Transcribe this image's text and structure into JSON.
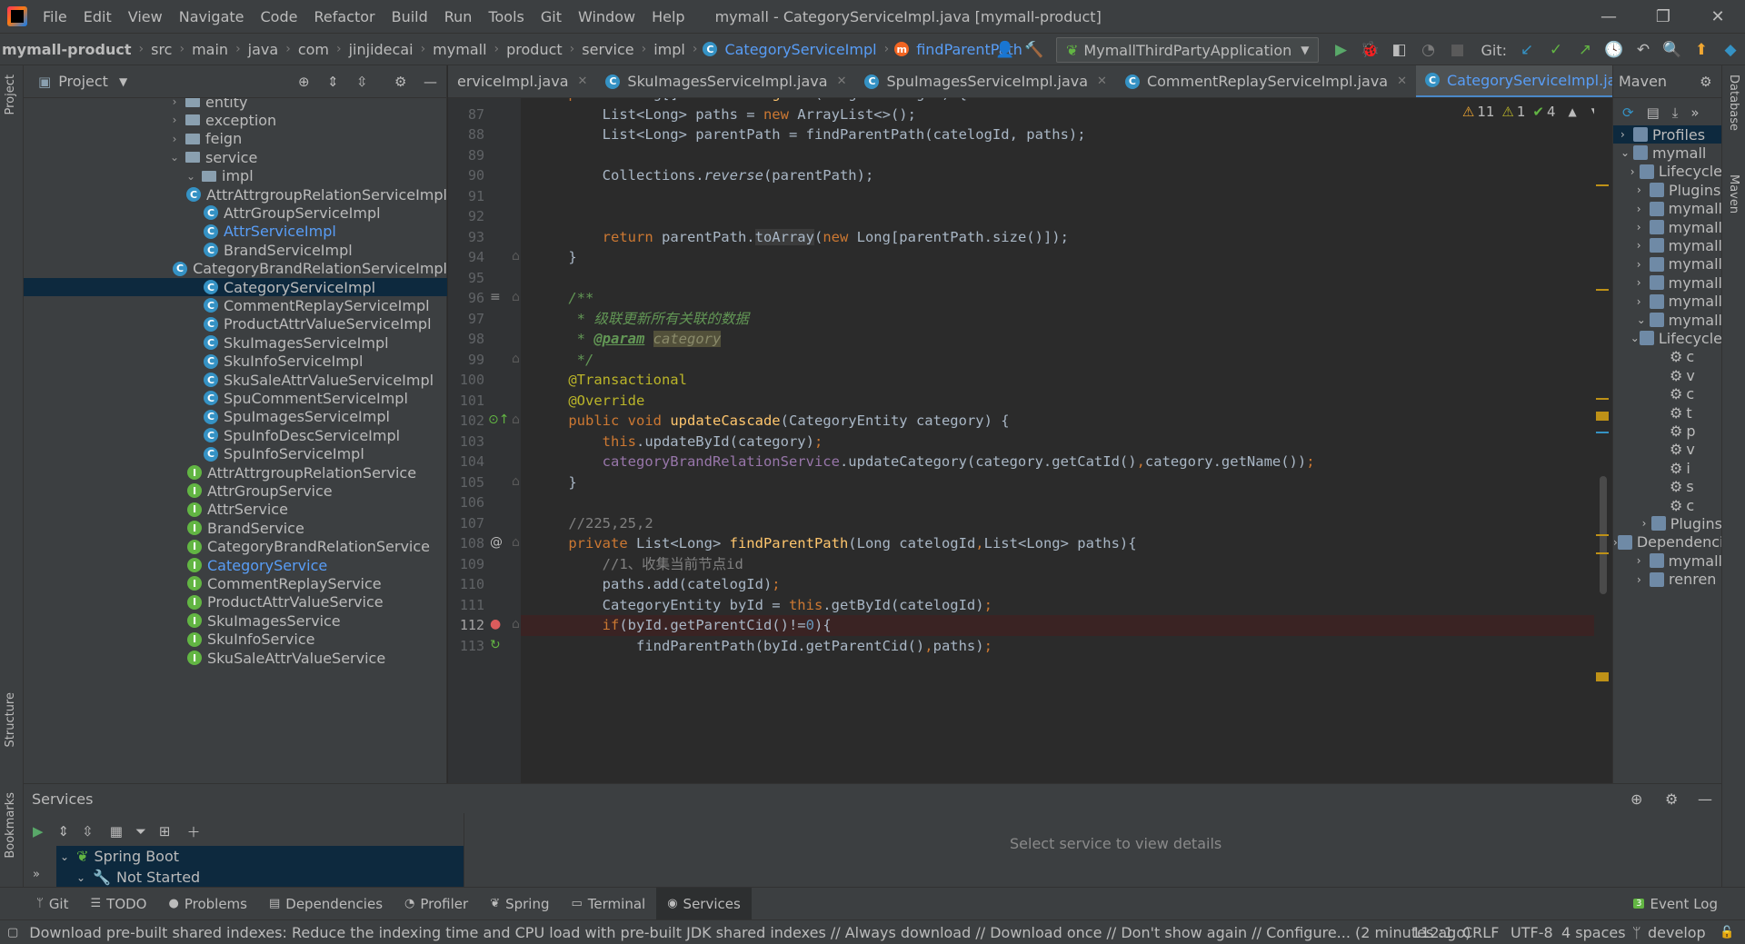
{
  "menubar": {
    "items": [
      "File",
      "Edit",
      "View",
      "Navigate",
      "Code",
      "Refactor",
      "Build",
      "Run",
      "Tools",
      "Git",
      "Window",
      "Help"
    ],
    "title": "mymall - CategoryServiceImpl.java [mymall-product]"
  },
  "navbar": {
    "crumbs": [
      "mymall-product",
      "src",
      "main",
      "java",
      "com",
      "jinjidecai",
      "mymall",
      "product",
      "service",
      "impl",
      "CategoryServiceImpl",
      "findParentPath"
    ],
    "run_config": "MymallThirdPartyApplication",
    "git_label": "Git:"
  },
  "project": {
    "title": "Project",
    "tree": [
      {
        "label": "entity",
        "kind": "folder",
        "indent": 1,
        "arrow": "right"
      },
      {
        "label": "exception",
        "kind": "folder",
        "indent": 1,
        "arrow": "right"
      },
      {
        "label": "feign",
        "kind": "folder",
        "indent": 1,
        "arrow": "right"
      },
      {
        "label": "service",
        "kind": "folder",
        "indent": 1,
        "arrow": "down"
      },
      {
        "label": "impl",
        "kind": "folder",
        "indent": 2,
        "arrow": "down"
      },
      {
        "label": "AttrAttrgroupRelationServiceImpl",
        "kind": "class",
        "indent": 3
      },
      {
        "label": "AttrGroupServiceImpl",
        "kind": "class",
        "indent": 3
      },
      {
        "label": "AttrServiceImpl",
        "kind": "class",
        "indent": 3,
        "blue": true
      },
      {
        "label": "BrandServiceImpl",
        "kind": "class",
        "indent": 3
      },
      {
        "label": "CategoryBrandRelationServiceImpl",
        "kind": "class",
        "indent": 3
      },
      {
        "label": "CategoryServiceImpl",
        "kind": "class",
        "indent": 3,
        "selected": true
      },
      {
        "label": "CommentReplayServiceImpl",
        "kind": "class",
        "indent": 3
      },
      {
        "label": "ProductAttrValueServiceImpl",
        "kind": "class",
        "indent": 3
      },
      {
        "label": "SkuImagesServiceImpl",
        "kind": "class",
        "indent": 3
      },
      {
        "label": "SkuInfoServiceImpl",
        "kind": "class",
        "indent": 3
      },
      {
        "label": "SkuSaleAttrValueServiceImpl",
        "kind": "class",
        "indent": 3
      },
      {
        "label": "SpuCommentServiceImpl",
        "kind": "class",
        "indent": 3
      },
      {
        "label": "SpuImagesServiceImpl",
        "kind": "class",
        "indent": 3
      },
      {
        "label": "SpuInfoDescServiceImpl",
        "kind": "class",
        "indent": 3
      },
      {
        "label": "SpuInfoServiceImpl",
        "kind": "class",
        "indent": 3
      },
      {
        "label": "AttrAttrgroupRelationService",
        "kind": "interface",
        "indent": 2
      },
      {
        "label": "AttrGroupService",
        "kind": "interface",
        "indent": 2
      },
      {
        "label": "AttrService",
        "kind": "interface",
        "indent": 2
      },
      {
        "label": "BrandService",
        "kind": "interface",
        "indent": 2
      },
      {
        "label": "CategoryBrandRelationService",
        "kind": "interface",
        "indent": 2
      },
      {
        "label": "CategoryService",
        "kind": "interface",
        "indent": 2,
        "blue": true
      },
      {
        "label": "CommentReplayService",
        "kind": "interface",
        "indent": 2
      },
      {
        "label": "ProductAttrValueService",
        "kind": "interface",
        "indent": 2
      },
      {
        "label": "SkuImagesService",
        "kind": "interface",
        "indent": 2
      },
      {
        "label": "SkuInfoService",
        "kind": "interface",
        "indent": 2
      },
      {
        "label": "SkuSaleAttrValueService",
        "kind": "interface",
        "indent": 2
      }
    ]
  },
  "tabs": [
    {
      "label": "erviceImpl.java",
      "active": false
    },
    {
      "label": "SkuImagesServiceImpl.java",
      "active": false
    },
    {
      "label": "SpuImagesServiceImpl.java",
      "active": false
    },
    {
      "label": "CommentReplayServiceImpl.java",
      "active": false
    },
    {
      "label": "CategoryServiceImpl.java",
      "active": true
    }
  ],
  "inspections": {
    "warnings": "11",
    "weak_warnings": "1",
    "typos": "4"
  },
  "code": [
    {
      "n": "86",
      "html": "    <span class=\"kw\">public</span> Long[] <span class=\"fn\">findCatelogPath</span>(Long catelogId) {"
    },
    {
      "n": "87",
      "html": "        List&lt;Long&gt; paths = <span class=\"kw\">new</span> ArrayList&lt;&gt;();"
    },
    {
      "n": "88",
      "html": "        List&lt;Long&gt; parentPath = findParentPath(catelogId, paths);"
    },
    {
      "n": "89",
      "html": ""
    },
    {
      "n": "90",
      "html": "        Collections.<i>reverse</i>(parentPath);"
    },
    {
      "n": "91",
      "html": ""
    },
    {
      "n": "92",
      "html": ""
    },
    {
      "n": "93",
      "html": "        <span class=\"kw\">return</span> parentPath.<span style=\"background:#3b3b3b\">toArray</span>(<span class=\"kw\">new</span> Long[parentPath.size()]);"
    },
    {
      "n": "94",
      "html": "    }"
    },
    {
      "n": "95",
      "html": ""
    },
    {
      "n": "96",
      "html": "    <span class=\"cm\">/**</span>"
    },
    {
      "n": "97",
      "html": "<span class=\"cm\">     * 级联更新所有关联的数据</span>"
    },
    {
      "n": "98",
      "html": "<span class=\"cm\">     * <b><u>@param</u></b> <span style=\"background:#52503a;color:#8a8a6a\">category</span></span>"
    },
    {
      "n": "99",
      "html": "<span class=\"cm\">     */</span>"
    },
    {
      "n": "100",
      "html": "    <span class=\"ann\">@Transactional</span>"
    },
    {
      "n": "101",
      "html": "    <span class=\"ann\">@Override</span>"
    },
    {
      "n": "102",
      "html": "    <span class=\"kw\">public void</span> <span class=\"fn\">updateCascade</span>(CategoryEntity category) {"
    },
    {
      "n": "103",
      "html": "        <span class=\"kw\">this</span>.updateById(category)<span class=\"kw\">;</span>"
    },
    {
      "n": "104",
      "html": "        <span class=\"fld\">categoryBrandRelationService</span>.updateCategory(category.getCatId()<span class=\"kw\">,</span>category.getName())<span class=\"kw\">;</span>"
    },
    {
      "n": "105",
      "html": "    }"
    },
    {
      "n": "106",
      "html": ""
    },
    {
      "n": "107",
      "html": "    <span class=\"gray\">//225,25,2</span>"
    },
    {
      "n": "108",
      "html": "    <span class=\"kw\">private</span> List&lt;Long&gt; <span class=\"fn\">findParentPath</span>(Long catelogId<span class=\"kw\">,</span>List&lt;Long&gt; paths){"
    },
    {
      "n": "109",
      "html": "        <span class=\"gray\">//1、收集当前节点id</span>"
    },
    {
      "n": "110",
      "html": "        paths.add(catelogId)<span class=\"kw\">;</span>"
    },
    {
      "n": "111",
      "html": "        CategoryEntity byId = <span class=\"kw\">this</span>.getById(catelogId)<span class=\"kw\">;</span>"
    },
    {
      "n": "112",
      "html": "        <span class=\"kw\">if</span>(byId.getParentCid()!=<span class=\"num\">0</span>){"
    },
    {
      "n": "113",
      "html": "            findParentPath(byId.getParentCid()<span class=\"kw\">,</span>paths)<span class=\"kw\">;</span>"
    }
  ],
  "maven": {
    "title": "Maven",
    "rows": [
      {
        "label": "Profiles",
        "indent": 0,
        "arrow": "right",
        "sel": true
      },
      {
        "label": "mymall",
        "indent": 0,
        "arrow": "down"
      },
      {
        "label": "Lifecycle",
        "indent": 1,
        "arrow": "right"
      },
      {
        "label": "Plugins",
        "indent": 1,
        "arrow": "right"
      },
      {
        "label": "mymall",
        "indent": 1,
        "arrow": "right"
      },
      {
        "label": "mymall",
        "indent": 1,
        "arrow": "right"
      },
      {
        "label": "mymall",
        "indent": 1,
        "arrow": "right"
      },
      {
        "label": "mymall",
        "indent": 1,
        "arrow": "right"
      },
      {
        "label": "mymall",
        "indent": 1,
        "arrow": "right"
      },
      {
        "label": "mymall",
        "indent": 1,
        "arrow": "right"
      },
      {
        "label": "mymall",
        "indent": 1,
        "arrow": "down"
      },
      {
        "label": "Lifecycle",
        "indent": 2,
        "arrow": "down"
      },
      {
        "label": "c",
        "indent": 3,
        "arrow": "gear"
      },
      {
        "label": "v",
        "indent": 3,
        "arrow": "gear"
      },
      {
        "label": "c",
        "indent": 3,
        "arrow": "gear"
      },
      {
        "label": "t",
        "indent": 3,
        "arrow": "gear"
      },
      {
        "label": "p",
        "indent": 3,
        "arrow": "gear"
      },
      {
        "label": "v",
        "indent": 3,
        "arrow": "gear"
      },
      {
        "label": "i",
        "indent": 3,
        "arrow": "gear"
      },
      {
        "label": "s",
        "indent": 3,
        "arrow": "gear"
      },
      {
        "label": "c",
        "indent": 3,
        "arrow": "gear"
      },
      {
        "label": "Plugins",
        "indent": 2,
        "arrow": "right"
      },
      {
        "label": "Dependencies",
        "indent": 2,
        "arrow": "right"
      },
      {
        "label": "mymall",
        "indent": 1,
        "arrow": "right"
      },
      {
        "label": "renren",
        "indent": 1,
        "arrow": "right"
      }
    ]
  },
  "services": {
    "title": "Services",
    "root": "Spring Boot",
    "child": "Not Started",
    "detail": "Select service to view details"
  },
  "toolwindows": [
    "Git",
    "TODO",
    "Problems",
    "Dependencies",
    "Profiler",
    "Spring",
    "Terminal",
    "Services"
  ],
  "event_log": "Event Log",
  "side_labels": {
    "project": "Project",
    "structure": "Structure",
    "bookmarks": "Bookmarks",
    "database": "Database",
    "maven": "Maven"
  },
  "status": {
    "message": "Download pre-built shared indexes: Reduce the indexing time and CPU load with pre-built JDK shared indexes // Always download // Download once // Don't show again // Configure... (2 minutes ago)",
    "position": "112:1",
    "line_sep": "CRLF",
    "encoding": "UTF-8",
    "indent": "4 spaces",
    "branch": "develop"
  }
}
